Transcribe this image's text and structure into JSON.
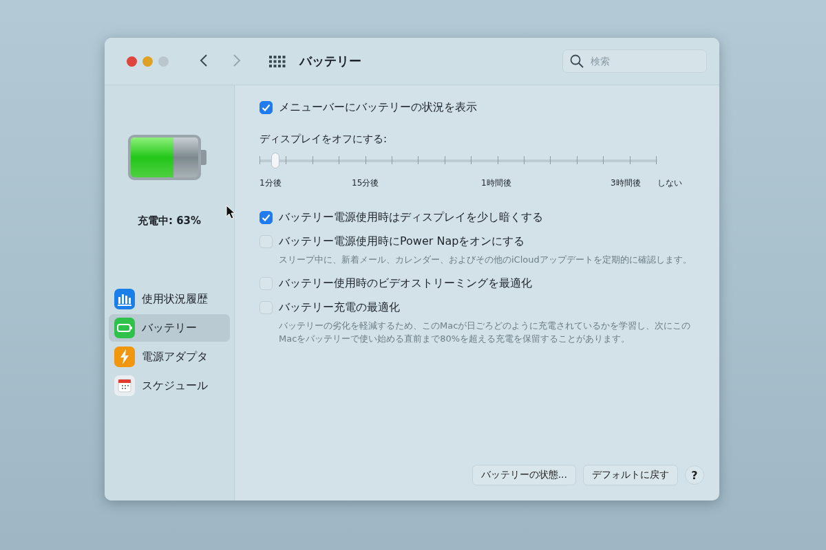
{
  "window": {
    "title": "バッテリー",
    "search": {
      "placeholder": "検索"
    }
  },
  "sidebar": {
    "battery": {
      "level": 0.63,
      "status": "充電中: 63%"
    },
    "items": [
      {
        "label": "使用状況履歴",
        "kind": "history",
        "selected": false
      },
      {
        "label": "バッテリー",
        "kind": "battery",
        "selected": true
      },
      {
        "label": "電源アダプタ",
        "kind": "adapter",
        "selected": false
      },
      {
        "label": "スケジュール",
        "kind": "schedule",
        "selected": false
      }
    ]
  },
  "options": [
    {
      "kind": "checkbox",
      "label": "メニューバーにバッテリーの状況を表示",
      "checked": true
    },
    {
      "kind": "slider",
      "label": "ディスプレイをオフにする:",
      "level": 0.04,
      "ticks": [
        "1分後",
        "15分後",
        "1時間後",
        "3時間後",
        "しない"
      ]
    },
    {
      "kind": "checkbox",
      "label": "バッテリー電源使用時はディスプレイを少し暗くする",
      "checked": true
    },
    {
      "kind": "checkbox",
      "label": "バッテリー電源使用時にPower Napをオンにする",
      "checked": false,
      "note": "スリープ中に、新着メール、カレンダー、およびその他のiCloudアップデートを定期的に確認します。"
    },
    {
      "kind": "checkbox",
      "label": "バッテリー使用時のビデオストリーミングを最適化",
      "checked": false
    },
    {
      "kind": "checkbox",
      "label": "バッテリー充電の最適化",
      "checked": false,
      "note": "バッテリーの劣化を軽減するため、このMacが日ごろどのように充電されているかを学習し、次にこのMacをバッテリーで使い始める直前まで80%を超える充電を保留することがあります。"
    }
  ],
  "buttons": [
    {
      "label": "バッテリーの状態..."
    },
    {
      "label": "デフォルトに戻す"
    },
    {
      "label": "?"
    }
  ]
}
